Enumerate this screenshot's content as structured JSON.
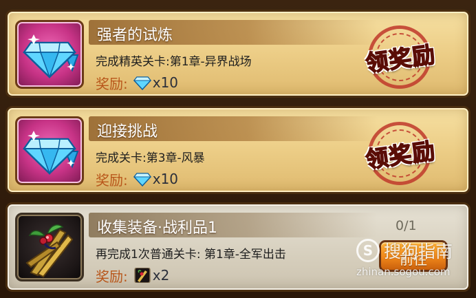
{
  "quests": [
    {
      "title": "强者的试炼",
      "description": "完成精英关卡:第1章-异界战场",
      "reward_label": "奖励:",
      "reward_item_icon": "diamond-icon",
      "reward_count": "x10",
      "action_label": "领奖励",
      "state": "claimable"
    },
    {
      "title": "迎接挑战",
      "description": "完成关卡:第3章-风暴",
      "reward_label": "奖励:",
      "reward_item_icon": "diamond-icon",
      "reward_count": "x10",
      "action_label": "领奖励",
      "state": "claimable"
    },
    {
      "title": "收集装备·战利品1",
      "description": "再完成1次普通关卡: 第1章-全军出击",
      "reward_label": "奖励:",
      "reward_item_icon": "loot-bundle-icon",
      "reward_count": "x2",
      "progress": "0/1",
      "action_label": "前往",
      "state": "in-progress"
    }
  ],
  "watermark": {
    "brand": "搜狗指南",
    "url": "zhinan.sogou.com"
  },
  "colors": {
    "card_bg": "#f0d28c",
    "card_bg_disabled": "#ddd6c6",
    "reward_label": "#b8561a",
    "stamp_red": "#ff3a2a",
    "goto_button": "#f0871a"
  }
}
